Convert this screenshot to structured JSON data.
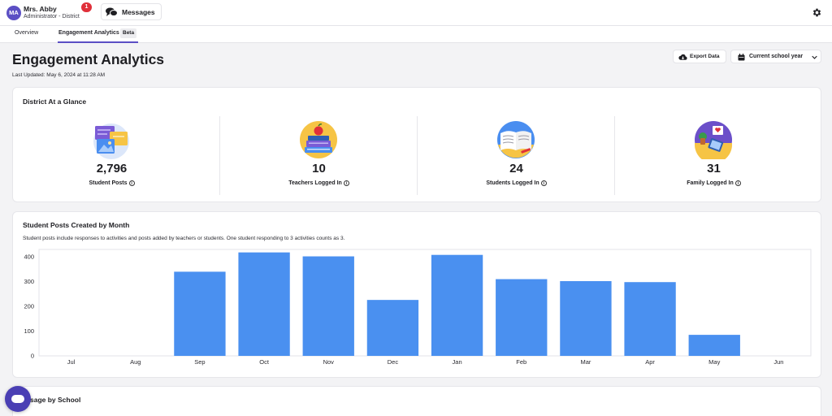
{
  "user": {
    "initials": "MA",
    "name": "Mrs. Abby",
    "role": "Administrator - District",
    "notifications": "1"
  },
  "messages": {
    "label": "Messages"
  },
  "tabs": [
    {
      "label": "Overview"
    },
    {
      "label": "Engagement Analytics",
      "badge": "Beta"
    }
  ],
  "page": {
    "title": "Engagement Analytics",
    "last_updated": "Last Updated: May 6, 2024 at 11:28 AM",
    "export_label": "Export Data",
    "year_select": "Current school year"
  },
  "glance": {
    "title": "District At a Glance",
    "stats": [
      {
        "value": "2,796",
        "label": "Student Posts",
        "icon": "posts-illustration"
      },
      {
        "value": "10",
        "label": "Teachers Logged In",
        "icon": "books-apple-illustration"
      },
      {
        "value": "24",
        "label": "Students Logged In",
        "icon": "open-book-illustration"
      },
      {
        "value": "31",
        "label": "Family Logged In",
        "icon": "family-tablet-illustration"
      }
    ]
  },
  "posts_chart": {
    "title": "Student Posts Created by Month",
    "description": "Student posts include responses to activities and posts added by teachers or students. One student responding to 3 activities counts as 3."
  },
  "school_section": {
    "title": "sage by School"
  },
  "colors": {
    "accent": "#5b4fc4",
    "bar": "#4a90f0",
    "badge": "#e0303a"
  },
  "chart_data": {
    "type": "bar",
    "categories": [
      "Jul",
      "Aug",
      "Sep",
      "Oct",
      "Nov",
      "Dec",
      "Jan",
      "Feb",
      "Mar",
      "Apr",
      "May",
      "Jun"
    ],
    "values": [
      0,
      0,
      340,
      418,
      402,
      226,
      408,
      310,
      302,
      298,
      85,
      0
    ],
    "yticks": [
      0,
      100,
      200,
      300,
      400
    ],
    "ylim": [
      0,
      430
    ],
    "grid": false,
    "legend": "none"
  }
}
